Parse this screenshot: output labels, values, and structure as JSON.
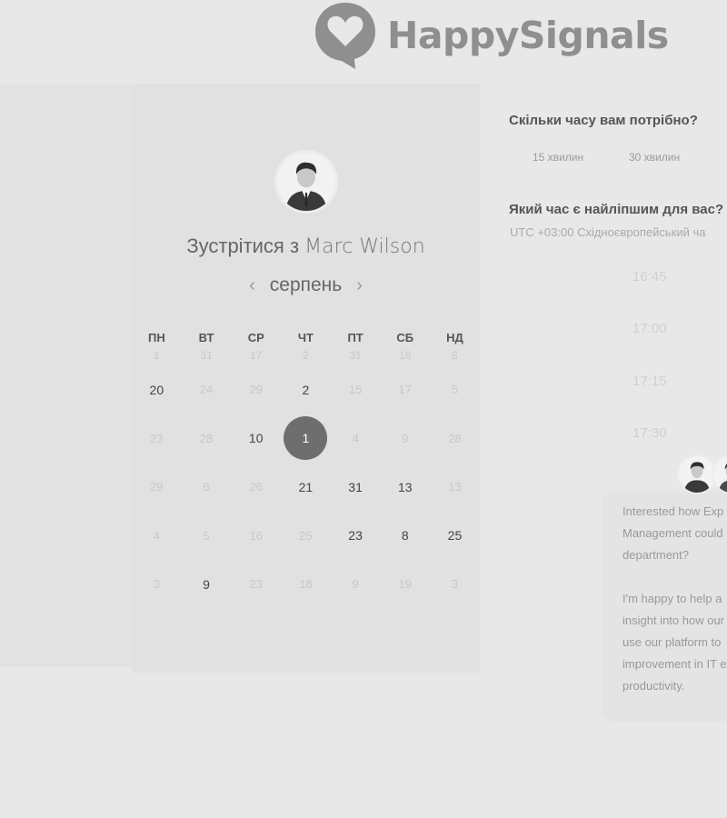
{
  "brand": {
    "name": "HappySignals",
    "accent": "#8f8f8f"
  },
  "calendar": {
    "title_prefix": "Зустрітися з",
    "host_name": "Marc Wilson",
    "month": "серпень",
    "prev_icon": "chevron-left-icon",
    "next_icon": "chevron-right-icon",
    "weekdays": [
      "ПН",
      "ВТ",
      "СР",
      "ЧТ",
      "ПТ",
      "СБ",
      "НД"
    ],
    "weeks": [
      [
        "1",
        "31",
        "17",
        "2",
        "31",
        "16",
        "8"
      ],
      [
        "20",
        "24",
        "29",
        "2",
        "15",
        "17",
        "5"
      ],
      [
        "23",
        "28",
        "10",
        "1",
        "4",
        "9",
        "28"
      ],
      [
        "29",
        "6",
        "26",
        "21",
        "31",
        "13",
        "13"
      ],
      [
        "4",
        "5",
        "16",
        "25",
        "23",
        "8",
        "25"
      ],
      [
        "3",
        "9",
        "23",
        "18",
        "9",
        "19",
        "3"
      ]
    ],
    "available": [
      [
        1,
        0
      ],
      [
        1,
        3
      ],
      [
        2,
        2
      ],
      [
        2,
        3
      ],
      [
        3,
        3
      ],
      [
        3,
        4
      ],
      [
        3,
        5
      ],
      [
        4,
        4
      ],
      [
        4,
        5
      ],
      [
        4,
        6
      ],
      [
        5,
        1
      ]
    ],
    "selected": [
      2,
      3
    ]
  },
  "duration": {
    "question": "Скільки часу вам потрібно?",
    "options": [
      "15 хвилин",
      "30 хвилин"
    ]
  },
  "time": {
    "question": "Який час є найліпшим для вас?",
    "timezone": "UTC +03:00 Східноєвропейський ча",
    "slots": [
      "16:45",
      "17:00",
      "17:15",
      "17:30"
    ]
  },
  "chat": {
    "lines": [
      "Interested how Exp",
      "Management could",
      "department?",
      "",
      "I'm happy to help a",
      "insight into how our",
      "use our platform to",
      "improvement in IT e",
      "productivity."
    ]
  }
}
